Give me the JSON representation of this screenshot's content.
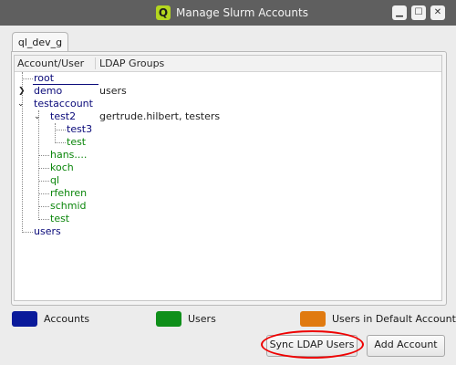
{
  "window": {
    "title": "Manage Slurm Accounts",
    "app_icon_letter": "Q"
  },
  "tab": {
    "label": "ql_dev_g"
  },
  "tree": {
    "columns": [
      "Account/User",
      "LDAP Groups"
    ],
    "rows": [
      {
        "label": "root",
        "ldap": ""
      },
      {
        "label": "demo",
        "ldap": "users"
      },
      {
        "label": "testaccount",
        "ldap": ""
      },
      {
        "label": "test2",
        "ldap": "gertrude.hilbert, testers"
      },
      {
        "label": "test3",
        "ldap": ""
      },
      {
        "label": "test",
        "ldap": ""
      },
      {
        "label": "hans....",
        "ldap": ""
      },
      {
        "label": "koch",
        "ldap": ""
      },
      {
        "label": "ql",
        "ldap": ""
      },
      {
        "label": "rfehren",
        "ldap": ""
      },
      {
        "label": "schmid",
        "ldap": ""
      },
      {
        "label": "test",
        "ldap": ""
      },
      {
        "label": "users",
        "ldap": ""
      }
    ]
  },
  "legend": {
    "accounts": {
      "label": "Accounts",
      "color": "#0a1a9a"
    },
    "users": {
      "label": "Users",
      "color": "#0f8f1a"
    },
    "default": {
      "label": "Users in Default Account",
      "color": "#e07a10"
    }
  },
  "buttons": {
    "sync": "Sync LDAP Users",
    "add": "Add Account"
  },
  "colors": {
    "account_text": "#0a0a7a",
    "user_text": "#0b860b",
    "highlight": "#ee0000"
  }
}
